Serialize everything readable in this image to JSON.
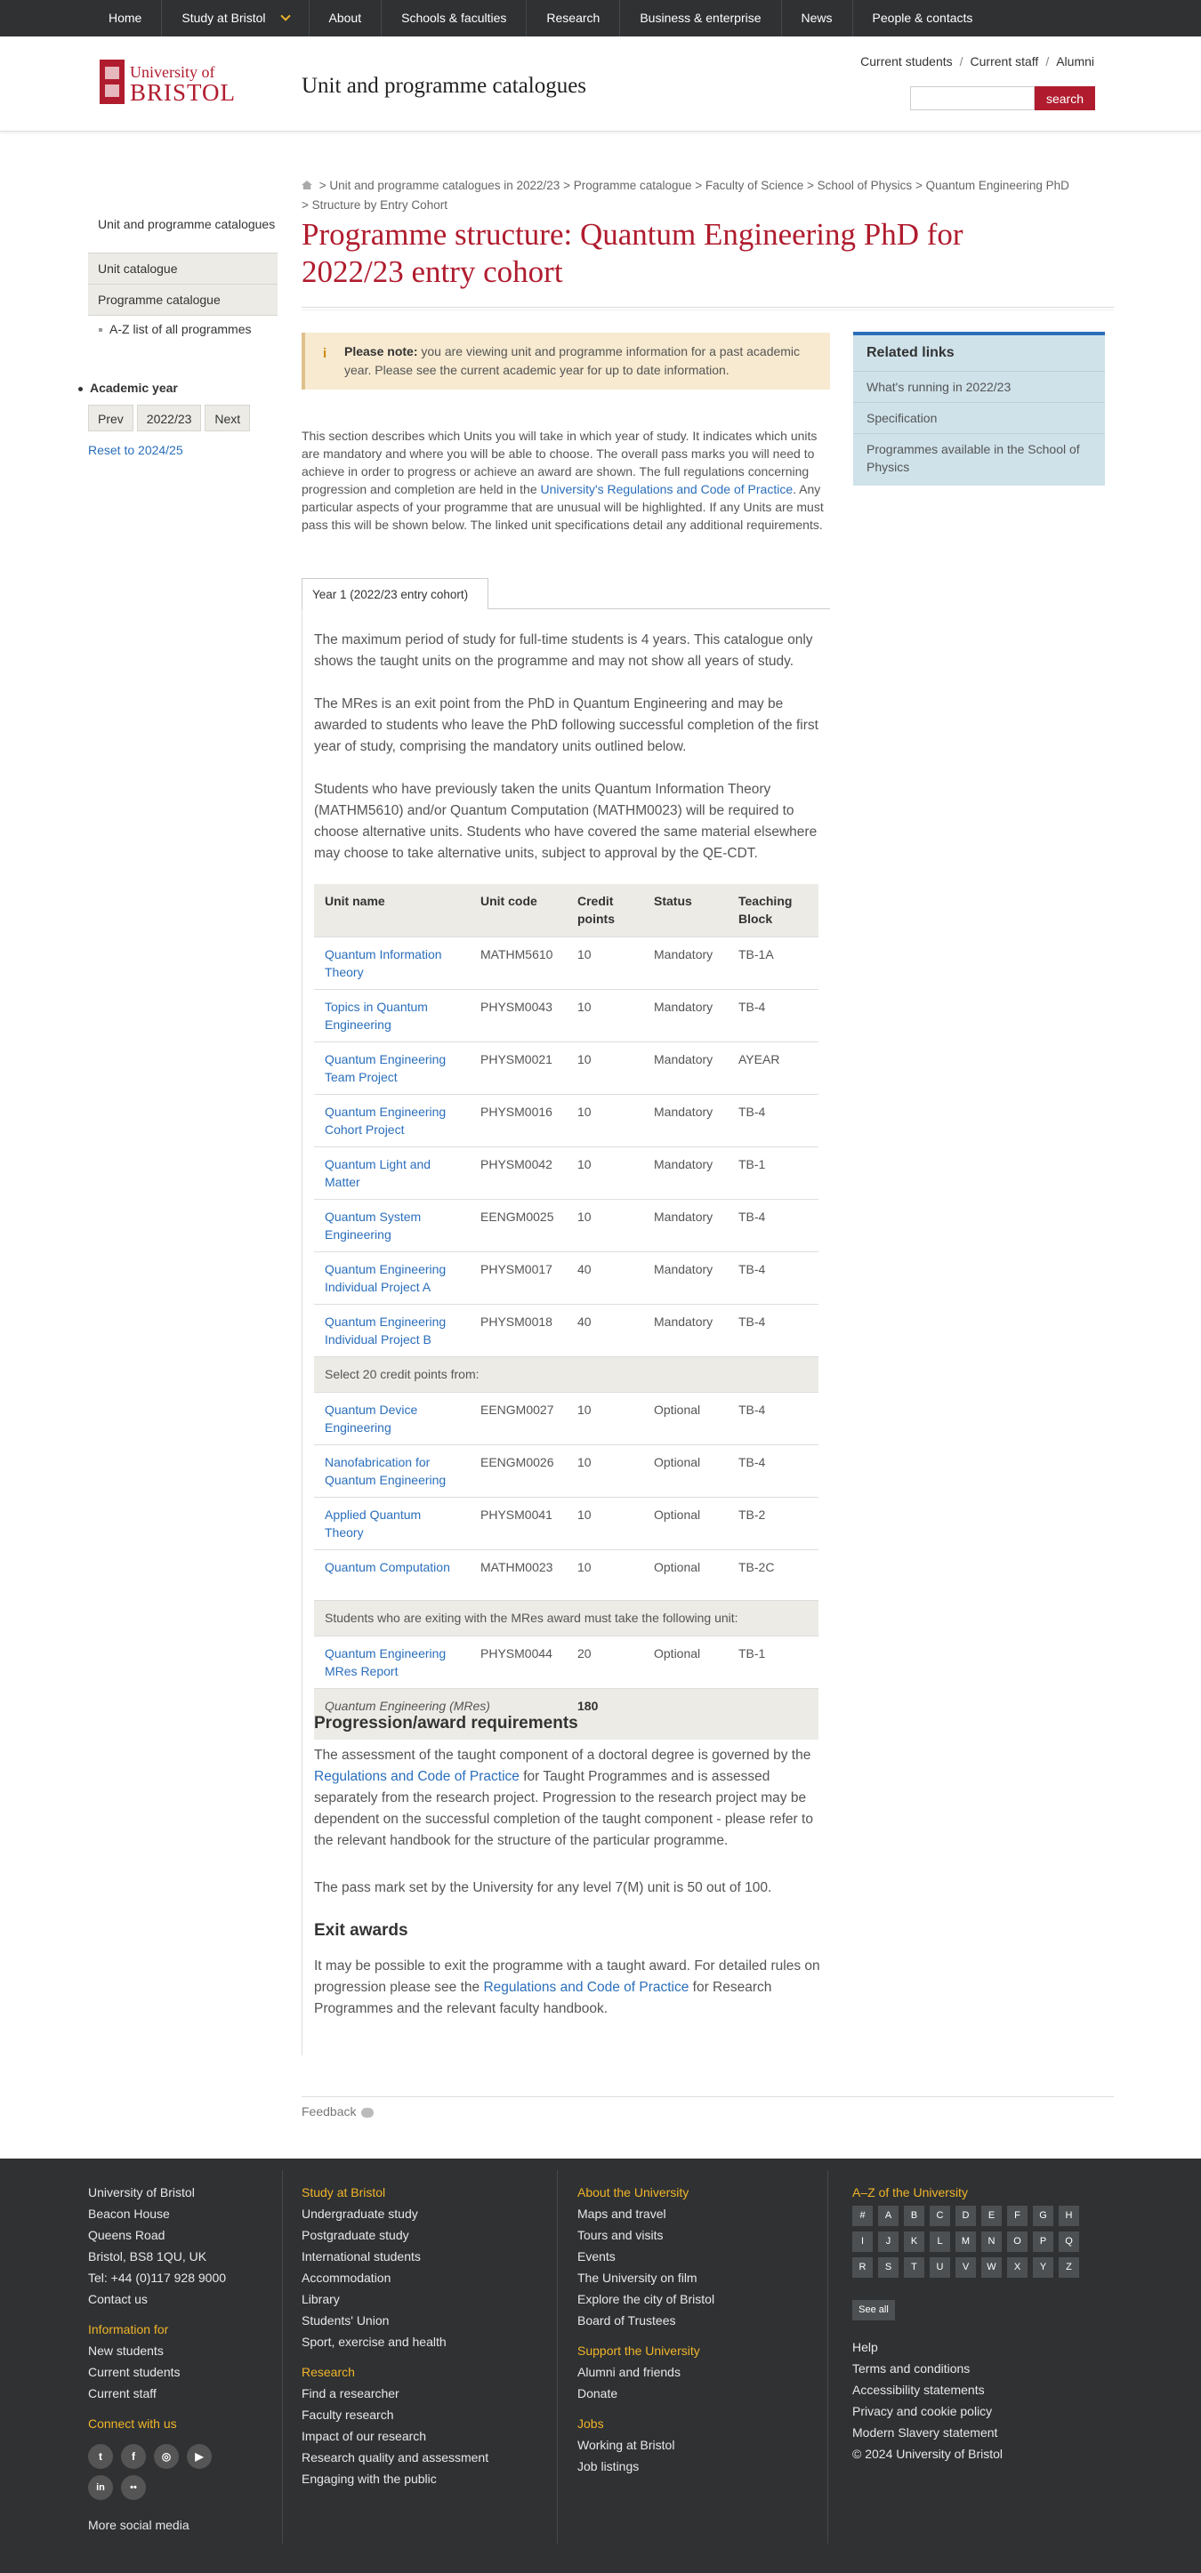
{
  "topnav": {
    "items": [
      "Home",
      "Study at Bristol",
      "About",
      "Schools & faculties",
      "Research",
      "Business & enterprise",
      "News",
      "People & contacts"
    ]
  },
  "header": {
    "logo_line1": "University of",
    "logo_line2": "BRISTOL",
    "site_title": "Unit and programme catalogues",
    "util": [
      "Current students",
      "Current staff",
      "Alumni"
    ],
    "search_button": "search",
    "search_value": ""
  },
  "sidebar": {
    "title": "Unit and programme catalogues",
    "items": [
      "Unit catalogue",
      "Programme catalogue"
    ],
    "az_link": "A-Z list of all programmes",
    "academic_year_label": "Academic year",
    "prev": "Prev",
    "year": "2022/23",
    "next": "Next",
    "reset": "Reset to 2024/25"
  },
  "breadcrumb": {
    "items": [
      "Unit and programme catalogues in 2022/23",
      "Programme catalogue",
      "Faculty of Science",
      "School of Physics",
      "Quantum Engineering PhD",
      "Structure by Entry Cohort"
    ]
  },
  "page_title": "Programme structure: Quantum Engineering PhD for 2022/23 entry cohort",
  "notice": {
    "icon": "i",
    "label": "Please note:",
    "text": "you are viewing unit and programme information for a past academic year. Please see the current academic year for up to date information."
  },
  "intro": {
    "before_link": "This section describes which Units you will take in which year of study. It indicates which units are mandatory and where you will be able to choose. The overall pass marks you will need to achieve in order to progress or achieve an award are shown. The full regulations concerning progression and completion are held in the ",
    "link": "University's Regulations and Code of Practice",
    "after_link": ". Any particular aspects of your programme that are unusual will be highlighted. If any Units are must pass this will be shown below. The linked unit specifications detail any additional requirements."
  },
  "tab": {
    "label": "Year 1 (2022/23 entry cohort)"
  },
  "year1": {
    "p1": "The maximum period of study for full-time students is 4 years. This catalogue only shows the taught units on the programme and may not show all years of study.",
    "p2": "The MRes is an exit point from the PhD in Quantum Engineering and may be awarded to students who leave the PhD following successful completion of the first year of study, comprising the mandatory units outlined below.",
    "p3": "Students who have previously taken the units Quantum Information Theory (MATHM5610) and/or Quantum Computation (MATHM0023) will be required to choose alternative units. Students who have covered the same material elsewhere may choose to take alternative units, subject to approval by the QE-CDT."
  },
  "table": {
    "headers": [
      "Unit name",
      "Unit code",
      "Credit points",
      "Status",
      "Teaching Block"
    ],
    "mandatory": [
      [
        "Quantum Information Theory",
        "MATHM5610",
        "10",
        "Mandatory",
        "TB-1A"
      ],
      [
        "Topics in Quantum Engineering",
        "PHYSM0043",
        "10",
        "Mandatory",
        "TB-4"
      ],
      [
        "Quantum Engineering Team Project",
        "PHYSM0021",
        "10",
        "Mandatory",
        "AYEAR"
      ],
      [
        "Quantum Engineering Cohort Project",
        "PHYSM0016",
        "10",
        "Mandatory",
        "TB-4"
      ],
      [
        "Quantum Light and Matter",
        "PHYSM0042",
        "10",
        "Mandatory",
        "TB-1"
      ],
      [
        "Quantum System Engineering",
        "EENGM0025",
        "10",
        "Mandatory",
        "TB-4"
      ],
      [
        "Quantum Engineering Individual Project A",
        "PHYSM0017",
        "40",
        "Mandatory",
        "TB-4"
      ],
      [
        "Quantum Engineering Individual Project B",
        "PHYSM0018",
        "40",
        "Mandatory",
        "TB-4"
      ]
    ],
    "group1": "Select 20 credit points from:",
    "optional": [
      [
        "Quantum Device Engineering",
        "EENGM0027",
        "10",
        "Optional",
        "TB-4"
      ],
      [
        "Nanofabrication for Quantum Engineering",
        "EENGM0026",
        "10",
        "Optional",
        "TB-4"
      ],
      [
        "Applied Quantum Theory",
        "PHYSM0041",
        "10",
        "Optional",
        "TB-2"
      ],
      [
        "Quantum Computation",
        "MATHM0023",
        "10",
        "Optional",
        "TB-2C"
      ]
    ],
    "group2": "Students who are exiting with the MRes award must take the following unit:",
    "exit": [
      [
        "Quantum Engineering MRes Report",
        "PHYSM0044",
        "20",
        "Optional",
        "TB-1"
      ]
    ],
    "total_label": "Quantum Engineering (MRes)",
    "total_credits": "180"
  },
  "progression": {
    "heading": "Progression/award requirements",
    "p1_before": "The assessment of the taught component of a doctoral degree is governed by the ",
    "p1_link": "Regulations and Code of Practice",
    "p1_after": " for Taught Programmes and is assessed separately from the research project. Progression to the research project may be dependent on the successful completion of the taught component - please refer to the relevant handbook for the structure of the particular programme.",
    "p2": "The pass mark set by the University for any level 7(M) unit is 50 out of 100."
  },
  "exit_awards": {
    "heading": "Exit awards",
    "before": "It may be possible to exit the programme with a taught award. For detailed rules on progression please see the ",
    "link": "Regulations and Code of Practice",
    "after": " for Research Programmes and the relevant faculty handbook."
  },
  "related": {
    "heading": "Related links",
    "items": [
      "What's running in 2022/23",
      "Specification",
      "Programmes available in the School of Physics"
    ]
  },
  "feedback": "Feedback",
  "footer": {
    "address": [
      "University of Bristol",
      "Beacon House",
      "Queens Road",
      "Bristol, BS8 1QU, UK",
      "Tel: +44 (0)117 928 9000",
      "Contact us"
    ],
    "info_heading": "Information for",
    "info": [
      "New students",
      "Current students",
      "Current staff"
    ],
    "connect_heading": "Connect with us",
    "social_row1": [
      "twitter-icon",
      "facebook-icon",
      "instagram-icon",
      "youtube-icon"
    ],
    "social_row2": [
      "linkedin-icon",
      "flickr-icon"
    ],
    "more_social": "More social media",
    "study_heading": "Study at Bristol",
    "study": [
      "Undergraduate study",
      "Postgraduate study",
      "International students",
      "Accommodation",
      "Library",
      "Students' Union",
      "Sport, exercise and health"
    ],
    "research_heading": "Research",
    "research": [
      "Find a researcher",
      "Faculty research",
      "Impact of our research",
      "Research quality and assessment",
      "Engaging with the public"
    ],
    "about_heading": "About the University",
    "about": [
      "Maps and travel",
      "Tours and visits",
      "Events",
      "The University on film",
      "Explore the city of Bristol",
      "Board of Trustees"
    ],
    "support_heading": "Support the University",
    "support": [
      "Alumni and friends",
      "Donate"
    ],
    "jobs_heading": "Jobs",
    "jobs": [
      "Working at Bristol",
      "Job listings"
    ],
    "az_heading": "A–Z of the University",
    "az": [
      "#",
      "A",
      "B",
      "C",
      "D",
      "E",
      "F",
      "G",
      "H",
      "I",
      "J",
      "K",
      "L",
      "M",
      "N",
      "O",
      "P",
      "Q",
      "R",
      "S",
      "T",
      "U",
      "V",
      "W",
      "X",
      "Y",
      "Z"
    ],
    "see_all": "See all",
    "legal": [
      "Help",
      "Terms and conditions",
      "Accessibility statements",
      "Privacy and cookie policy",
      "Modern Slavery statement",
      "© 2024 University of Bristol"
    ]
  },
  "colors": {
    "brand": "#b01c2e",
    "link": "#2a6ebb",
    "footer_bg": "#2f3133",
    "footer_heading": "#f0b429",
    "notice_bg": "#f7ead0",
    "related_bg": "#cfe2ea"
  }
}
